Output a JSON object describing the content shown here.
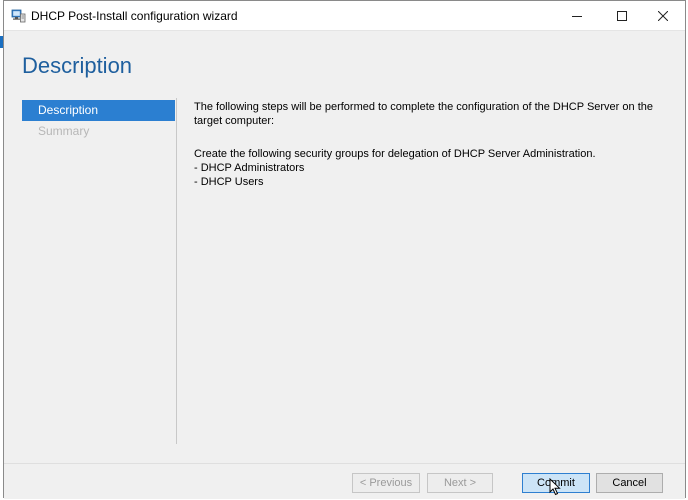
{
  "window": {
    "title": "DHCP Post-Install configuration wizard",
    "controls": {
      "minimize_icon": "minimize-icon",
      "maximize_icon": "maximize-icon",
      "close_icon": "close-icon"
    }
  },
  "page": {
    "title": "Description"
  },
  "nav": {
    "items": [
      {
        "label": "Description",
        "state": "active"
      },
      {
        "label": "Summary",
        "state": "disabled"
      }
    ]
  },
  "body": {
    "intro": "The following steps will be performed to complete the configuration of the DHCP Server on the target computer:",
    "groups_heading": "Create the following security groups for delegation of DHCP Server Administration.",
    "groups": [
      "- DHCP Administrators",
      "- DHCP Users"
    ]
  },
  "footer": {
    "previous_label": "< Previous",
    "next_label": "Next >",
    "commit_label": "Commit",
    "cancel_label": "Cancel"
  },
  "colors": {
    "accent": "#2b7fd1",
    "title_blue": "#1e5f9e",
    "disabled_text": "#b7b7b7"
  }
}
